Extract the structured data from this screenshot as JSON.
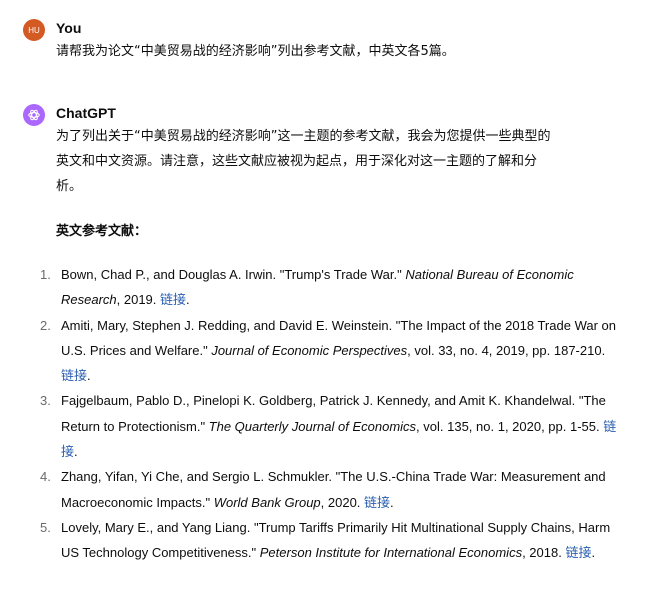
{
  "user": {
    "avatar_initials": "HU",
    "name": "You",
    "message": "请帮我为论文“中美贸易战的经济影响”列出参考文献，中英文各5篇。"
  },
  "assistant": {
    "name": "ChatGPT",
    "intro_line1": "为了列出关于“中美贸易战的经济影响”这一主题的参考文献，我会为您提供一些典型的",
    "intro_line2": "英文和中文资源。请注意，这些文献应被视为起点，用于深化对这一主题的了解和分",
    "intro_line3": "析。",
    "section_heading": "英文参考文献：",
    "link_label": "链接",
    "references": [
      {
        "num": "1.",
        "pre": "Bown, Chad P., and Douglas A. Irwin. \"Trump's Trade War.\" ",
        "ital": "National Bureau of Economic Research",
        "post": ", 2019. "
      },
      {
        "num": "2.",
        "pre": "Amiti, Mary, Stephen J. Redding, and David E. Weinstein. \"The Impact of the 2018 Trade War on U.S. Prices and Welfare.\" ",
        "ital": "Journal of Economic Perspectives",
        "post": ", vol. 33, no. 4, 2019, pp. 187-210. "
      },
      {
        "num": "3.",
        "pre": "Fajgelbaum, Pablo D., Pinelopi K. Goldberg, Patrick J. Kennedy, and Amit K. Khandelwal. \"The Return to Protectionism.\" ",
        "ital": "The Quarterly Journal of Economics",
        "post": ", vol. 135, no. 1, 2020, pp. 1-55. "
      },
      {
        "num": "4.",
        "pre": "Zhang, Yifan, Yi Che, and Sergio L. Schmukler. \"The U.S.-China Trade War: Measurement and Macroeconomic Impacts.\" ",
        "ital": "World Bank Group",
        "post": ", 2020. "
      },
      {
        "num": "5.",
        "pre": "Lovely, Mary E., and Yang Liang. \"Trump Tariffs Primarily Hit Multinational Supply Chains, Harm US Technology Competitiveness.\" ",
        "ital": "Peterson Institute for International Economics",
        "post": ", 2018. "
      }
    ]
  },
  "colors": {
    "user_avatar": "#d35a23",
    "assistant_avatar": "#ab68ff",
    "link": "#2a5fb0"
  },
  "icons": {
    "assistant_avatar": "openai-logo-icon"
  }
}
